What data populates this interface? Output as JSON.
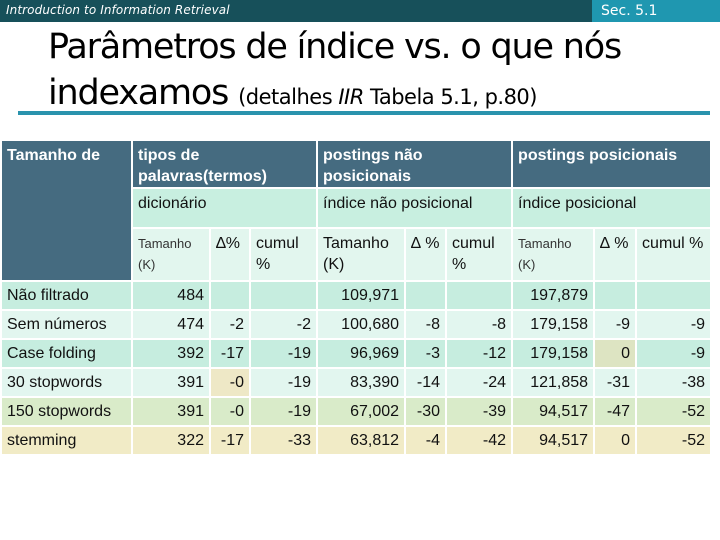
{
  "header": {
    "course": "Introduction to Information Retrieval",
    "section": "Sec. 5.1"
  },
  "title": {
    "line1": "Parâmetros de índice vs. o que nós",
    "line2_main": "indexamos ",
    "line2_sub_prefix": "(detalhes ",
    "line2_sub_italic": "IIR",
    "line2_sub_suffix": " Tabela 5.1, p.80)"
  },
  "table": {
    "corner": "Tamanho de",
    "groups": [
      {
        "title": "tipos de palavras(termos)",
        "subtitle": "dicionário",
        "cols": [
          "Tamanho (K)",
          "∆%",
          "cumul %"
        ]
      },
      {
        "title": "postings não posicionais",
        "subtitle": "índice não posicional",
        "cols": [
          "Tamanho (K)",
          "∆ %",
          "cumul %"
        ]
      },
      {
        "title": "postings posicionais",
        "subtitle": "índice posicional",
        "cols": [
          "Tamanho (K)",
          "∆ %",
          "cumul %"
        ]
      }
    ],
    "rows": [
      {
        "label": "Não filtrado",
        "values": [
          "484",
          "",
          "",
          "109,971",
          "",
          "",
          "197,879",
          "",
          ""
        ]
      },
      {
        "label": "Sem números",
        "values": [
          "474",
          "-2",
          "-2",
          "100,680",
          "-8",
          "-8",
          "179,158",
          "-9",
          "-9"
        ]
      },
      {
        "label": "Case folding",
        "values": [
          "392",
          "-17",
          "-19",
          "96,969",
          "-3",
          "-12",
          "179,158",
          "0",
          "-9"
        ]
      },
      {
        "label": "30 stopwords",
        "values": [
          "391",
          "-0",
          "-19",
          "83,390",
          "-14",
          "-24",
          "121,858",
          "-31",
          "-38"
        ]
      },
      {
        "label": "150 stopwords",
        "values": [
          "391",
          "-0",
          "-19",
          "67,002",
          "-30",
          "-39",
          "94,517",
          "-47",
          "-52"
        ]
      },
      {
        "label": "stemming",
        "values": [
          "322",
          "-17",
          "-33",
          "63,812",
          "-4",
          "-42",
          "94,517",
          "0",
          "-52"
        ]
      }
    ]
  }
}
